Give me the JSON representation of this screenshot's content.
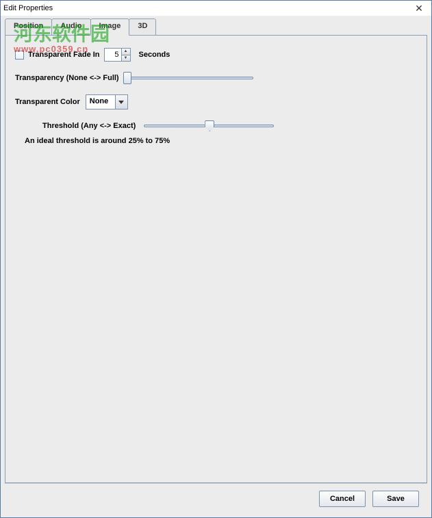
{
  "window": {
    "title": "Edit Properties"
  },
  "tabs": {
    "items": [
      {
        "label": "Position"
      },
      {
        "label": "Audio"
      },
      {
        "label": "Image"
      },
      {
        "label": "3D"
      }
    ]
  },
  "fadein": {
    "label": "Transparent Fade In",
    "value": "5",
    "unit": "Seconds",
    "checked": false
  },
  "transparency": {
    "label": "Transparency (None <-> Full)",
    "value_percent": 0
  },
  "transparent_color": {
    "label": "Transparent Color",
    "value": "None"
  },
  "threshold": {
    "label": "Threshold (Any <-> Exact)",
    "value_percent": 50,
    "note": "An ideal threshold is around 25%  to 75%"
  },
  "footer": {
    "cancel": "Cancel",
    "save": "Save"
  },
  "watermark": {
    "chinese": "河东软件园",
    "url": "www.pc0359.cn"
  }
}
